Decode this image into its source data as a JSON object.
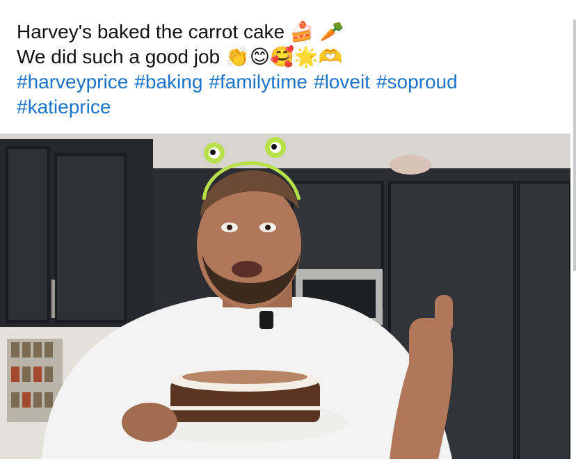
{
  "post": {
    "caption_line1": "Harvey's baked the carrot cake",
    "caption_line1_emoji": "🍰 🥕",
    "caption_line2": "We did such a good job",
    "caption_line2_emoji": "👏😊🥰🌟🫶",
    "hashtags": [
      "#harveyprice",
      "#baking",
      "#familytime",
      "#loveit",
      "#soproud",
      "#katieprice"
    ]
  },
  "colors": {
    "hashtag": "#1a73c9",
    "text": "#111111",
    "cabinet": "#2b2d33"
  },
  "icons": [
    "cake-emoji",
    "carrot-emoji",
    "clapping-emoji",
    "smile-emoji",
    "smiling-hearts-emoji",
    "star-emoji",
    "heart-hands-emoji"
  ]
}
